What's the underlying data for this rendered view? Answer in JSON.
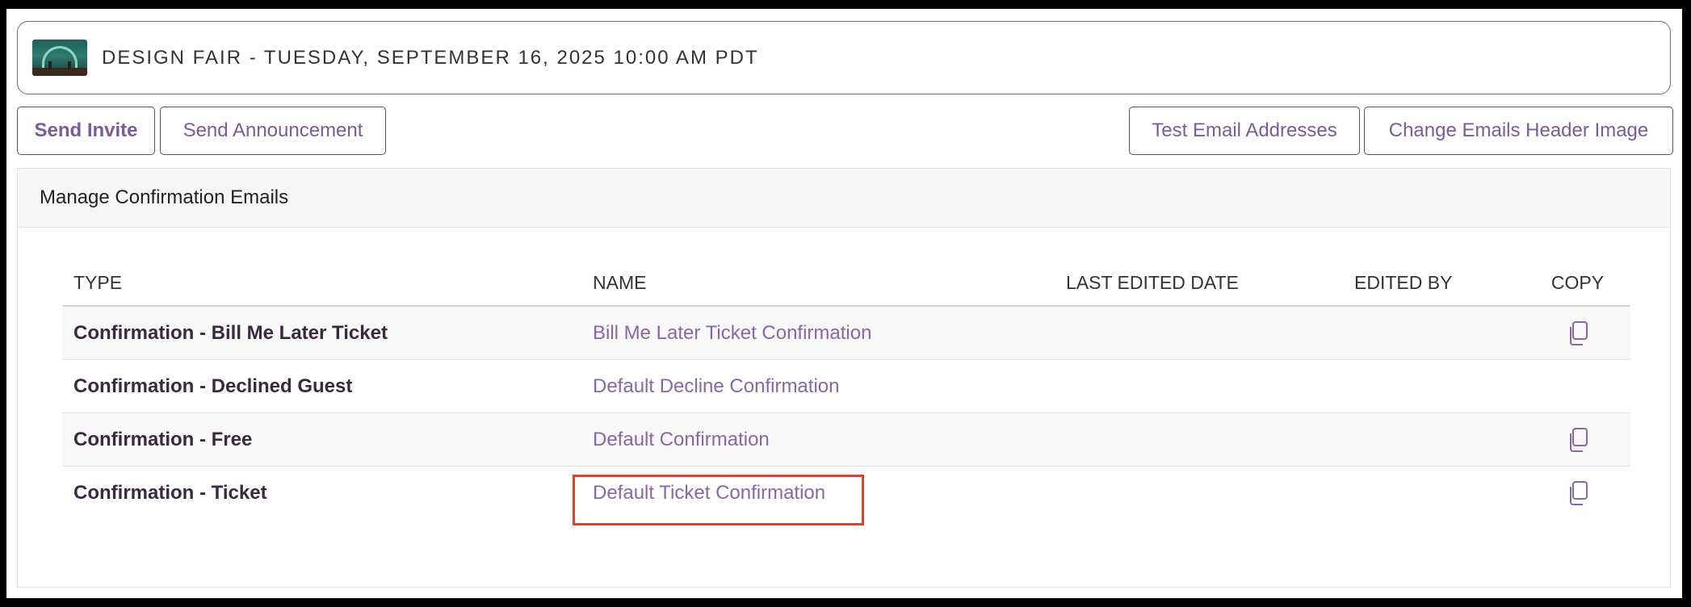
{
  "event": {
    "title": "DESIGN FAIR - TUESDAY, SEPTEMBER 16, 2025 10:00 AM PDT",
    "thumbnail_icon": "event-image"
  },
  "toolbar": {
    "send_invite": "Send Invite",
    "send_announcement": "Send Announcement",
    "test_email_addresses": "Test Email Addresses",
    "change_header_image": "Change Emails Header Image"
  },
  "panel": {
    "title": "Manage Confirmation Emails"
  },
  "table": {
    "headers": {
      "type": "TYPE",
      "name": "NAME",
      "last_edited": "LAST EDITED DATE",
      "edited_by": "EDITED BY",
      "copy": "COPY"
    },
    "rows": [
      {
        "type": "Confirmation - Bill Me Later Ticket",
        "name": "Bill Me Later Ticket Confirmation",
        "last_edited": "",
        "edited_by": "",
        "copy_icon": "copy-icon",
        "has_copy": true
      },
      {
        "type": "Confirmation - Declined Guest",
        "name": "Default Decline Confirmation",
        "last_edited": "",
        "edited_by": "",
        "has_copy": false
      },
      {
        "type": "Confirmation - Free",
        "name": "Default Confirmation",
        "last_edited": "",
        "edited_by": "",
        "copy_icon": "copy-icon",
        "has_copy": true
      },
      {
        "type": "Confirmation - Ticket",
        "name": "Default Ticket Confirmation",
        "last_edited": "",
        "edited_by": "",
        "copy_icon": "copy-icon",
        "has_copy": true
      }
    ]
  },
  "colors": {
    "accent": "#8a66a6",
    "highlight_box": "#e0402a"
  }
}
